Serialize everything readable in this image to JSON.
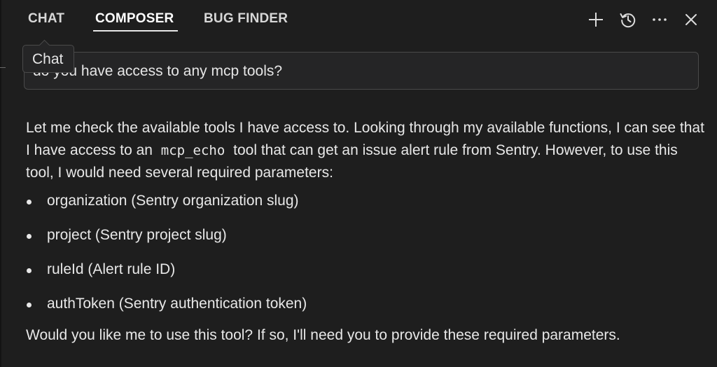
{
  "tabs": [
    {
      "label": "CHAT"
    },
    {
      "label": "COMPOSER",
      "active": true
    },
    {
      "label": "BUG FINDER"
    }
  ],
  "toolbar_icons": [
    "plus-icon",
    "history-icon",
    "more-icon",
    "close-icon"
  ],
  "tooltip": {
    "text": "Chat"
  },
  "prompt": {
    "text": "do you have access to any mcp tools?"
  },
  "response": {
    "intro_before_code": "Let me check the available tools I have access to. Looking through my available functions, I can see that I have access to an",
    "code": "mcp_echo",
    "intro_after_code": "tool that can get an issue alert rule from Sentry. However, to use this tool, I would need several required parameters:",
    "bullets": [
      "organization (Sentry organization slug)",
      "project (Sentry project slug)",
      "ruleId (Alert rule ID)",
      "authToken (Sentry authentication token)"
    ],
    "closing": "Would you like me to use this tool? If so, I'll need you to provide these required parameters."
  },
  "colors": {
    "background": "#1e1e1e",
    "text": "#e8e8e8",
    "border": "#4a4a4a",
    "input_background": "#252526"
  }
}
